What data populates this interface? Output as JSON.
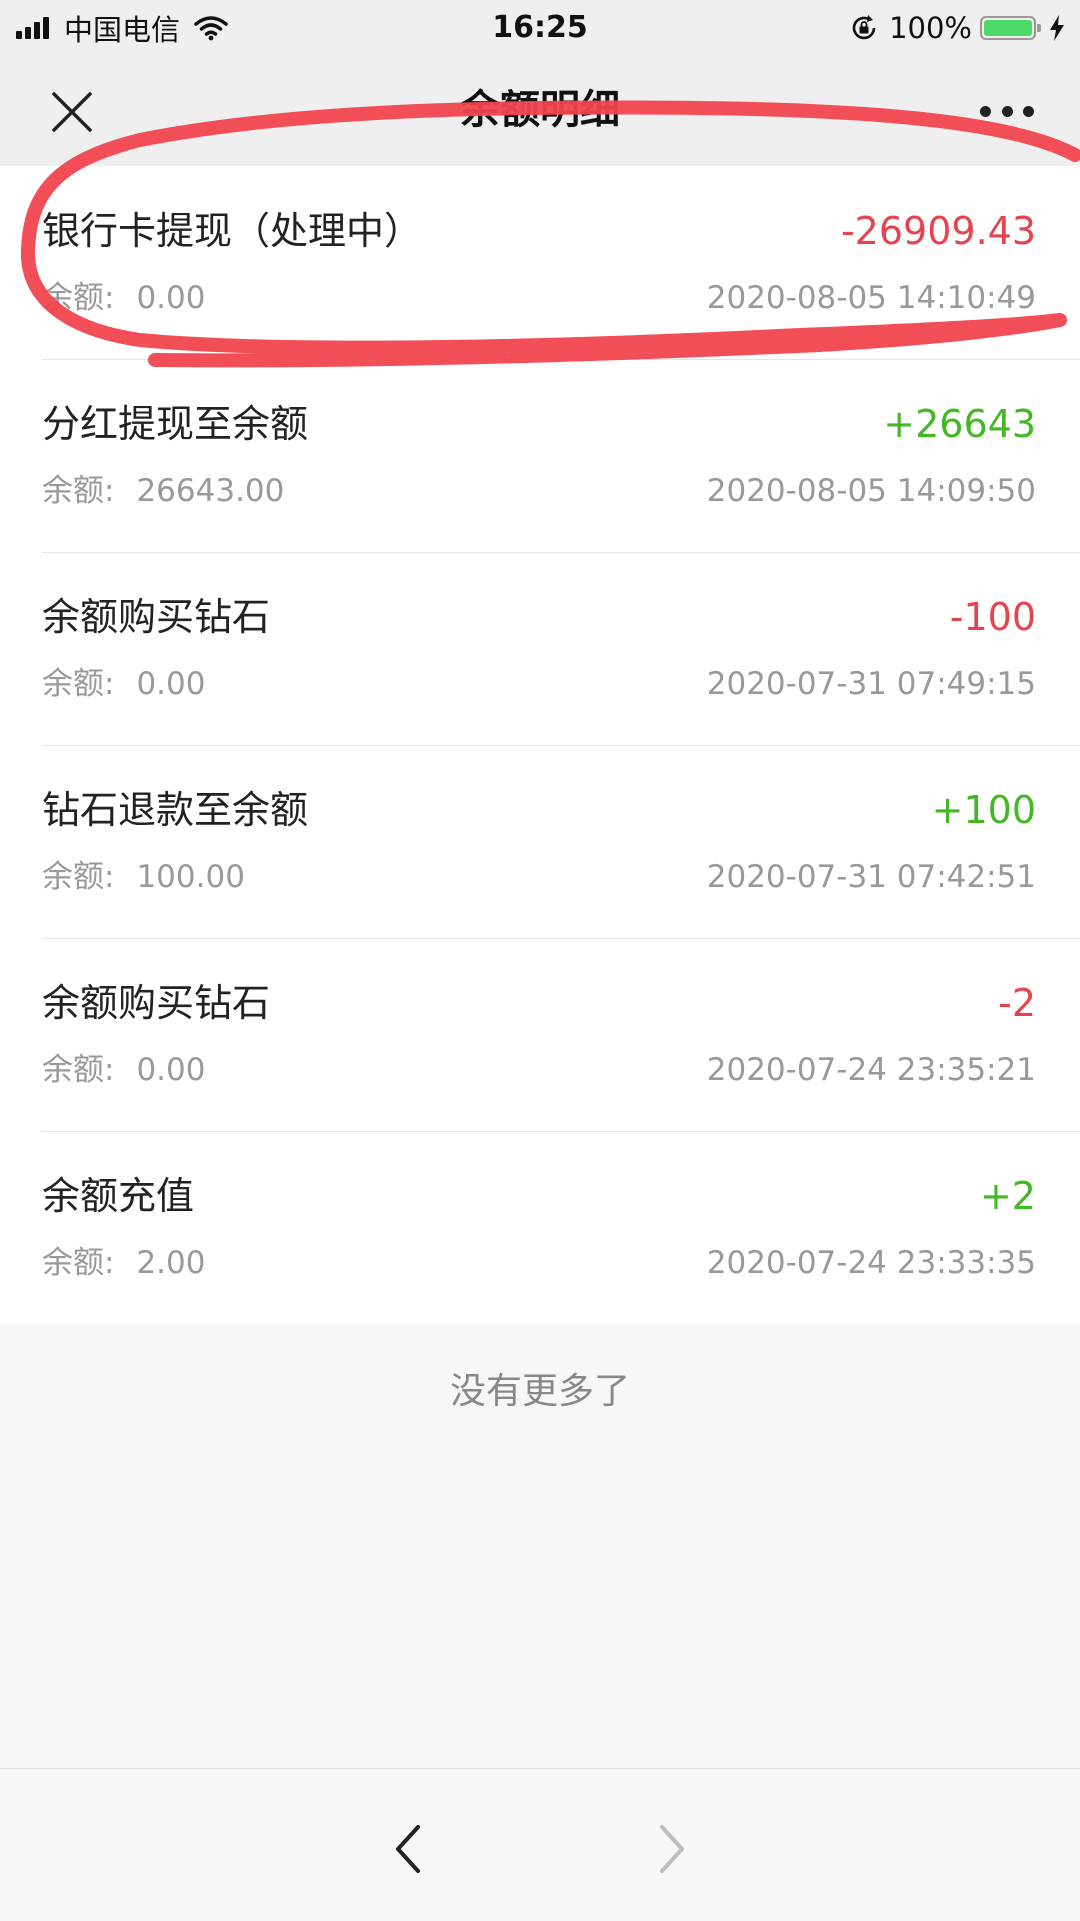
{
  "status_bar": {
    "carrier": "中国电信",
    "time": "16:25",
    "battery_percent": "100%"
  },
  "nav": {
    "title": "余额明细"
  },
  "transactions": [
    {
      "title": "银行卡提现（处理中）",
      "amount": "-26909.43",
      "balance_label": "余额:",
      "balance": "0.00",
      "time": "2020-08-05 14:10:49"
    },
    {
      "title": "分红提现至余额",
      "amount": "+26643",
      "balance_label": "余额:",
      "balance": "26643.00",
      "time": "2020-08-05 14:09:50"
    },
    {
      "title": "余额购买钻石",
      "amount": "-100",
      "balance_label": "余额:",
      "balance": "0.00",
      "time": "2020-07-31 07:49:15"
    },
    {
      "title": "钻石退款至余额",
      "amount": "+100",
      "balance_label": "余额:",
      "balance": "100.00",
      "time": "2020-07-31 07:42:51"
    },
    {
      "title": "余额购买钻石",
      "amount": "-2",
      "balance_label": "余额:",
      "balance": "0.00",
      "time": "2020-07-24 23:35:21"
    },
    {
      "title": "余额充值",
      "amount": "+2",
      "balance_label": "余额:",
      "balance": "2.00",
      "time": "2020-07-24 23:33:35"
    }
  ],
  "footer": {
    "no_more": "没有更多了"
  },
  "colors": {
    "negative": "#e64350",
    "positive": "#43b824",
    "highlight": "#f0444f"
  },
  "icons": {
    "close": "close-icon",
    "more": "more-icon",
    "back": "chevron-left-icon",
    "forward": "chevron-right-icon"
  }
}
